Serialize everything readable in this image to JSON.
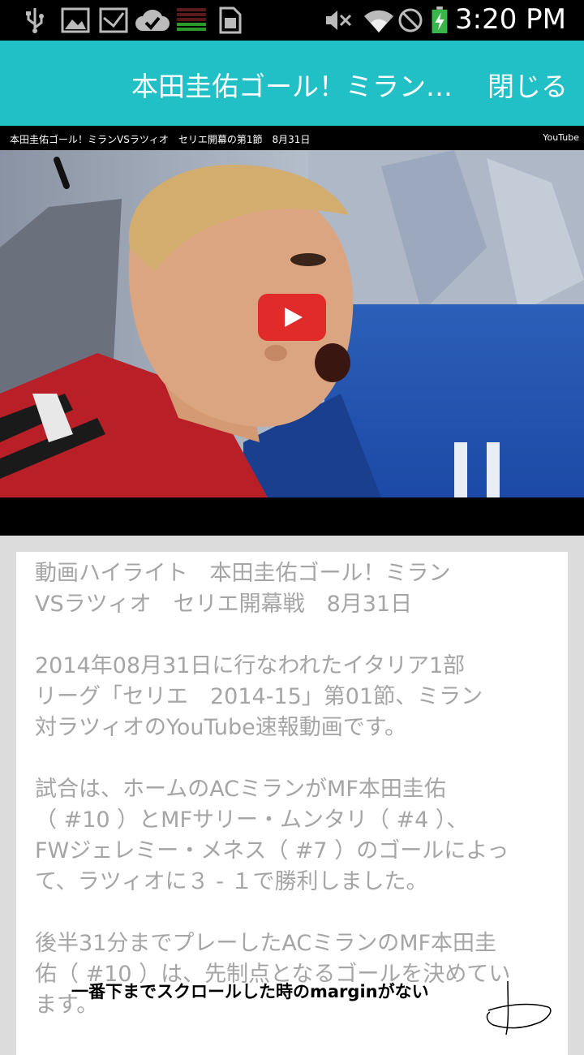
{
  "status_bar": {
    "time": "3:20 PM",
    "icons_left": [
      "usb-icon",
      "image-icon",
      "mail-icon",
      "cloud-check-icon",
      "signal-meter-icon",
      "sim-card-icon"
    ],
    "icons_right": [
      "mute-icon",
      "wifi-icon",
      "blocked-icon",
      "battery-charging-icon"
    ]
  },
  "app_bar": {
    "title": "本田圭佑ゴール！ミランVS…",
    "close_label": "閉じる",
    "background": "#21c0c6"
  },
  "video": {
    "caption": "本田圭佑ゴール！ミランVSラツィオ　セリエ開幕の第1節　8月31日",
    "source": "YouTube",
    "play_color": "#e12b2b"
  },
  "article": {
    "paragraphs": [
      [
        "動画ハイライト　本田圭佑ゴール！ミラン",
        "VSラツィオ　セリエ開幕戦　8月31日"
      ],
      [
        "2014年08月31日に行なわれたイタリア1部",
        "リーグ「セリエ　2014-15」第01節、ミラン",
        "対ラツィオのYouTube速報動画です。"
      ],
      [
        "試合は、ホームのACミランがMF本田圭佑",
        "（ #10 ）とMFサリー・ムンタリ（ #4 ）、",
        "FWジェレミー・メネス（ #7 ）のゴールによっ",
        "て、ラツィオに３ - １で勝利しました。"
      ],
      [
        "後半31分までプレーしたACミランのMF本田圭",
        "佑（ #10 ）は、先制点となるゴールを決めてい",
        "ます。"
      ]
    ]
  },
  "annotation": {
    "note": "一番下までスクロールした時のmarginがない"
  }
}
